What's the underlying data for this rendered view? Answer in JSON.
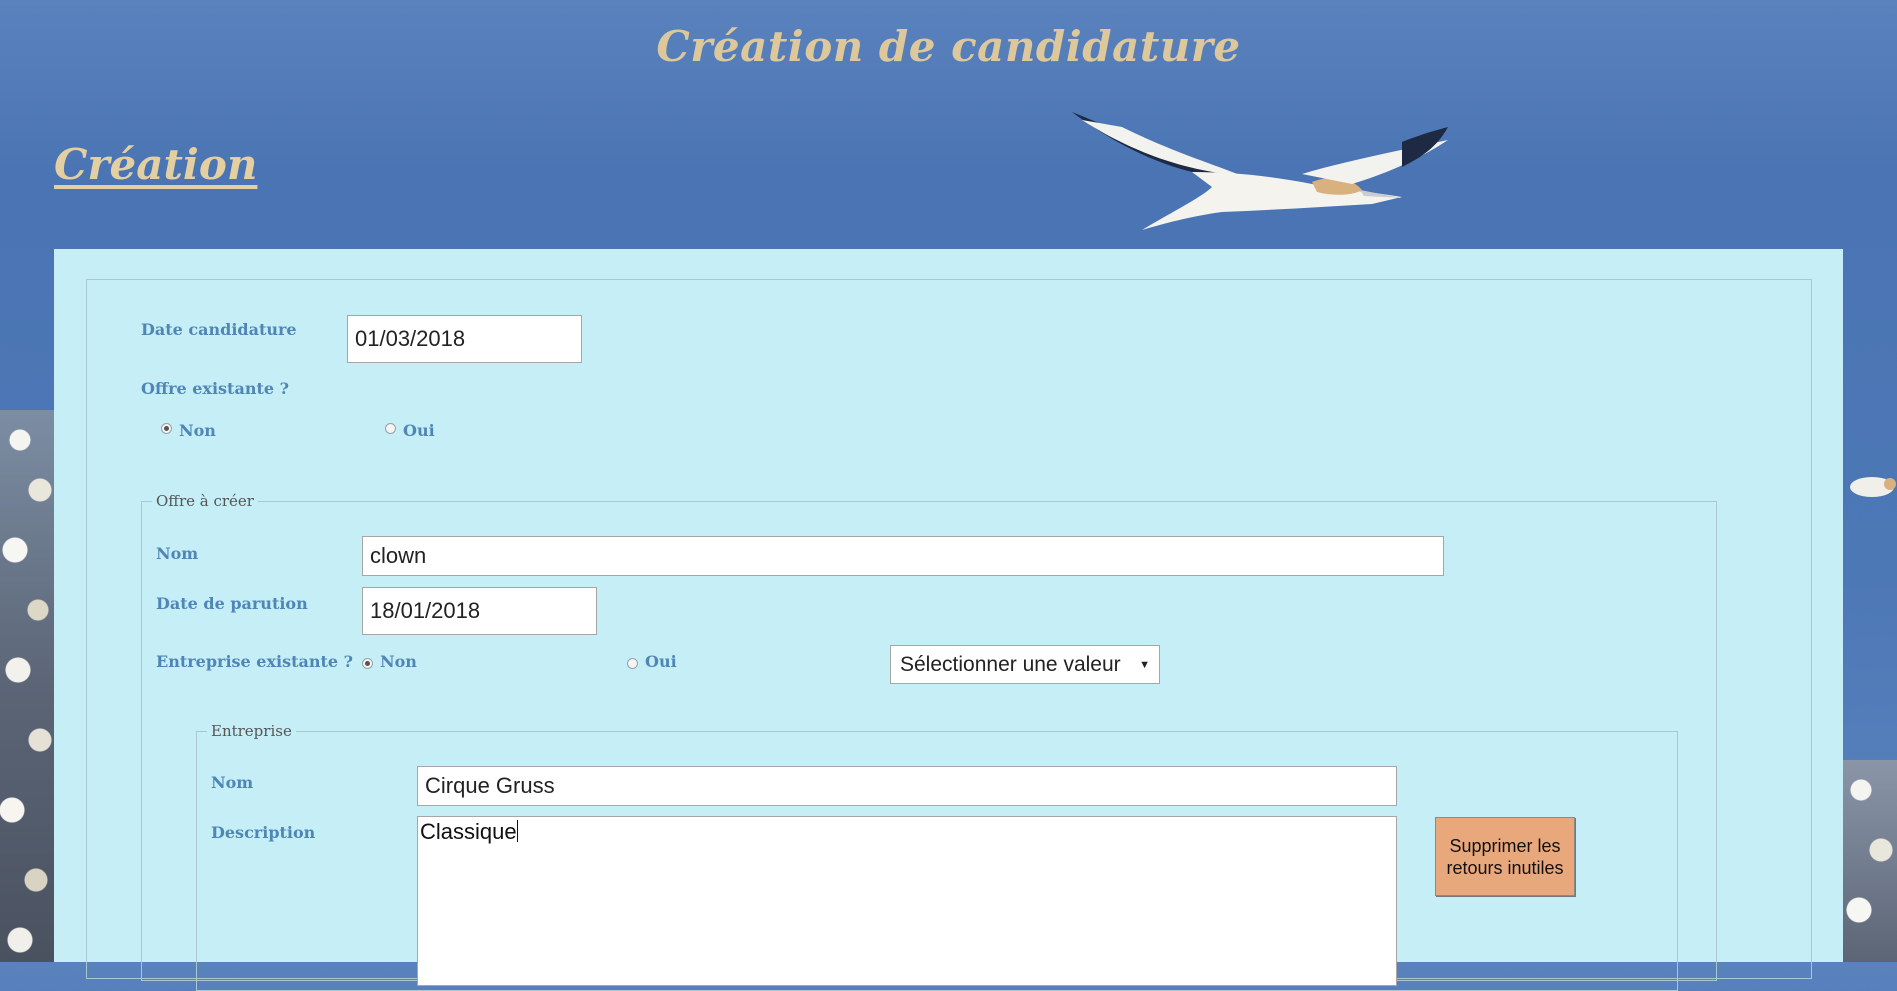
{
  "header": {
    "title": "Création de candidature"
  },
  "section": {
    "title": "Création"
  },
  "form": {
    "date_candidature": {
      "label": "Date candidature",
      "value": "01/03/2018"
    },
    "offre_existante": {
      "label": "Offre existante ?",
      "options": [
        "Non",
        "Oui"
      ],
      "selected": "Non"
    },
    "offre_a_creer": {
      "legend": "Offre à créer",
      "nom": {
        "label": "Nom",
        "value": "clown"
      },
      "date_parution": {
        "label": "Date de parution",
        "value": "18/01/2018"
      },
      "entreprise_existante": {
        "label": "Entreprise existante ?",
        "options": [
          "Non",
          "Oui"
        ],
        "selected": "Non",
        "select_value": "Sélectionner une valeur"
      },
      "entreprise": {
        "legend": "Entreprise",
        "nom": {
          "label": "Nom",
          "value": "Cirque Gruss"
        },
        "description": {
          "label": "Description",
          "value": "Classique"
        },
        "button_label": "Supprimer les retours inutiles"
      }
    }
  },
  "colors": {
    "panel_bg": "#c5eef7",
    "label": "#4f86b6",
    "title": "#dcc89a",
    "button_bg": "#e9a87c"
  }
}
